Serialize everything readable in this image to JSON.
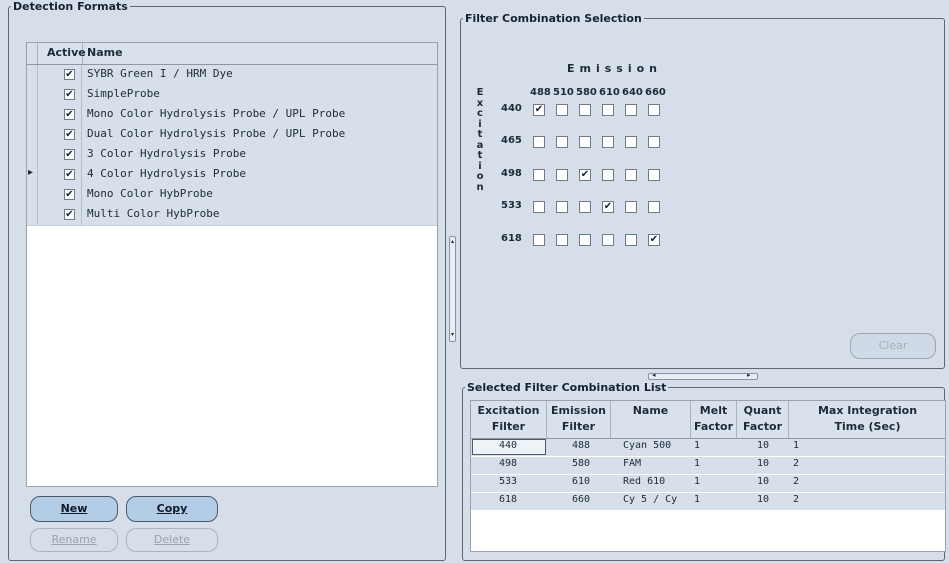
{
  "detection_formats": {
    "title": "Detection Formats",
    "col_active": "Active",
    "col_name": "Name",
    "items": [
      {
        "active": true,
        "name": "SYBR Green I / HRM Dye"
      },
      {
        "active": true,
        "name": "SimpleProbe"
      },
      {
        "active": true,
        "name": "Mono Color Hydrolysis Probe / UPL Probe"
      },
      {
        "active": true,
        "name": "Dual Color Hydrolysis Probe / UPL Probe"
      },
      {
        "active": true,
        "name": "3 Color Hydrolysis Probe"
      },
      {
        "active": true,
        "name": "4 Color Hydrolysis Probe",
        "current": true
      },
      {
        "active": true,
        "name": "Mono Color HybProbe"
      },
      {
        "active": true,
        "name": "Multi Color HybProbe"
      }
    ],
    "buttons": {
      "new": "New",
      "copy": "Copy",
      "rename": "Rename",
      "delete": "Delete"
    }
  },
  "filter_selection": {
    "title": "Filter Combination Selection",
    "emission_label": "Emission",
    "excitation_label": "Excitation",
    "emission": [
      "488",
      "510",
      "580",
      "610",
      "640",
      "660"
    ],
    "excitation": [
      "440",
      "465",
      "498",
      "533",
      "618"
    ],
    "checked": [
      [
        true,
        false,
        false,
        false,
        false,
        false
      ],
      [
        false,
        false,
        false,
        false,
        false,
        false
      ],
      [
        false,
        false,
        true,
        false,
        false,
        false
      ],
      [
        false,
        false,
        false,
        true,
        false,
        false
      ],
      [
        false,
        false,
        false,
        false,
        false,
        true
      ]
    ],
    "clear_label": "Clear"
  },
  "filter_list": {
    "title": "Selected Filter Combination List",
    "headers": [
      "Excitation Filter",
      "Emission Filter",
      "Name",
      "Melt Factor",
      "Quant Factor",
      "Max Integration Time (Sec)"
    ],
    "header_lines": [
      [
        "Excitation",
        "Filter"
      ],
      [
        "Emission",
        "Filter"
      ],
      [
        "Name",
        ""
      ],
      [
        "Melt",
        "Factor"
      ],
      [
        "Quant",
        "Factor"
      ],
      [
        "Max Integration",
        "Time (Sec)"
      ]
    ],
    "rows": [
      [
        "440",
        "488",
        "Cyan 500",
        "1",
        "10",
        "1"
      ],
      [
        "498",
        "580",
        "FAM",
        "1",
        "10",
        "2"
      ],
      [
        "533",
        "610",
        "Red 610",
        "1",
        "10",
        "2"
      ],
      [
        "618",
        "660",
        "Cy 5 / Cy",
        "1",
        "10",
        "2"
      ]
    ]
  },
  "colors": {
    "accent": "#b4cde6",
    "background": "#d6dfe9"
  }
}
